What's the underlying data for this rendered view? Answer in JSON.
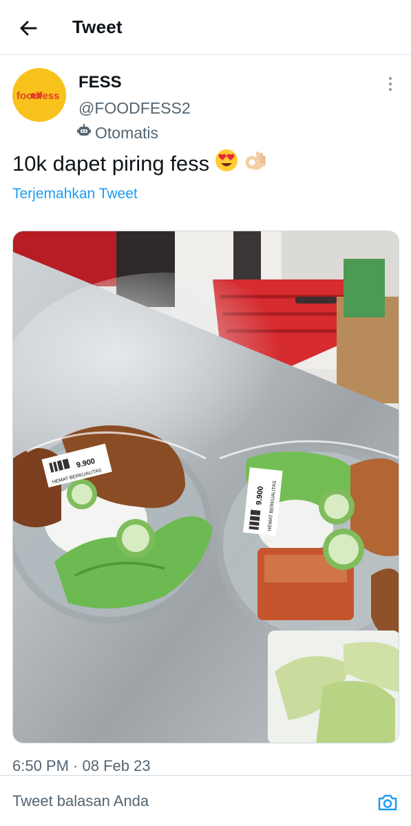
{
  "header": {
    "title": "Tweet"
  },
  "tweet": {
    "author_name": "FESS",
    "author_handle": "@FOODFESS2",
    "automated_label": "Otomatis",
    "avatar_text": "foodfess",
    "text": "10k dapet piring fess",
    "emojis": [
      "smiling-face-with-heart-eyes",
      "ok-hand"
    ],
    "translate_label": "Terjemahkan Tweet",
    "timestamp": "6:50 PM · 08 Feb 23"
  },
  "media": {
    "description": "photo of two packaged rice meals on a steel counter",
    "label_text": "HEMAT BERKUALITAS",
    "price_left": "9.900",
    "price_right": "9.900"
  },
  "reply": {
    "placeholder": "Tweet balasan Anda"
  }
}
